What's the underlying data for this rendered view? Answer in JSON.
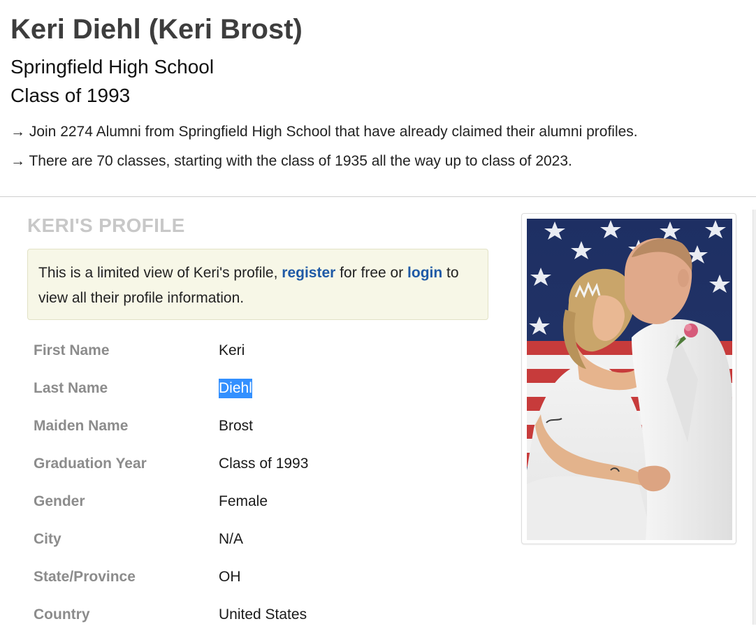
{
  "header": {
    "name_title": "Keri Diehl (Keri Brost)",
    "school": "Springfield High School",
    "class_of": "Class of 1993",
    "info_join": "→ Join 2274 Alumni from Springfield High School that have already claimed their alumni profiles.",
    "info_classes": "→ There are 70 classes, starting with the class of 1935 all the way up to class of 2023."
  },
  "profile": {
    "heading": "KERI'S PROFILE",
    "notice": {
      "text_before_register": "This is a limited view of Keri's profile, ",
      "register_link": "register",
      "text_between": " for free or ",
      "login_link": "login",
      "text_after_login": " to view all their profile information."
    },
    "fields": [
      {
        "label": "First Name",
        "value": "Keri"
      },
      {
        "label": "Last Name",
        "value": "Diehl"
      },
      {
        "label": "Maiden Name",
        "value": "Brost"
      },
      {
        "label": "Graduation Year",
        "value": "Class of 1993"
      },
      {
        "label": "Gender",
        "value": "Female"
      },
      {
        "label": "City",
        "value": "N/A"
      },
      {
        "label": "State/Province",
        "value": "OH"
      },
      {
        "label": "Country",
        "value": "United States"
      }
    ]
  },
  "colors": {
    "link": "#1f5aa6",
    "heading_muted": "#c8c8c8",
    "label_gray": "#8c8c8c",
    "notice_bg": "#f7f7e7",
    "selection": "#3390ff"
  }
}
